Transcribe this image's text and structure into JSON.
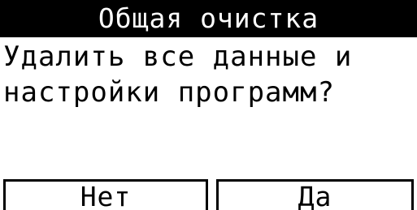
{
  "dialog": {
    "title": "Общая очистка",
    "message": "Удалить все данные и\nнастройки программ?",
    "no_label": "Нет",
    "yes_label": "Да"
  },
  "colors": {
    "title_background": "#000000",
    "title_text": "#ffffff",
    "background": "#ffffff",
    "text": "#000000"
  }
}
